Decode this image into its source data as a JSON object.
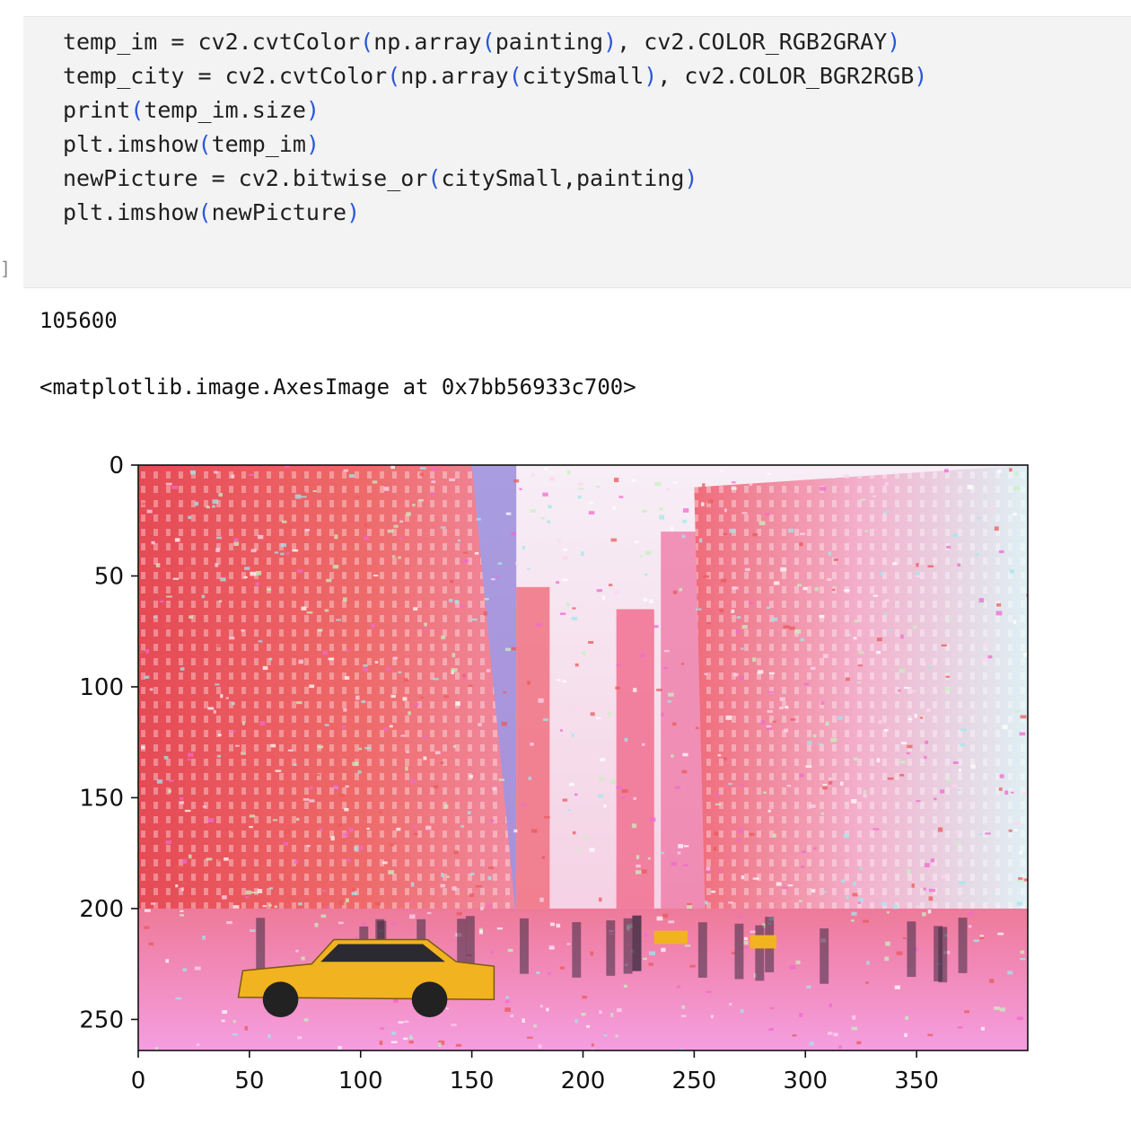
{
  "cell": {
    "prompt": "]",
    "lines": [
      [
        [
          "temp_im = cv2.cvtColor",
          ""
        ],
        [
          "(",
          "p"
        ],
        [
          "np.array",
          ""
        ],
        [
          "(",
          "p"
        ],
        [
          "painting",
          ""
        ],
        [
          ")",
          "p"
        ],
        [
          ", cv2.COLOR_RGB2GRAY",
          ""
        ],
        [
          ")",
          "p"
        ]
      ],
      [
        [
          "temp_city = cv2.cvtColor",
          ""
        ],
        [
          "(",
          "p"
        ],
        [
          "np.array",
          ""
        ],
        [
          "(",
          "p"
        ],
        [
          "citySmall",
          ""
        ],
        [
          ")",
          "p"
        ],
        [
          ", cv2.COLOR_BGR2RGB",
          ""
        ],
        [
          ")",
          "p"
        ]
      ],
      [
        [
          "print",
          ""
        ],
        [
          "(",
          "p"
        ],
        [
          "temp_im.size",
          ""
        ],
        [
          ")",
          "p"
        ]
      ],
      [
        [
          "plt.imshow",
          ""
        ],
        [
          "(",
          "p"
        ],
        [
          "temp_im",
          ""
        ],
        [
          ")",
          "p"
        ]
      ],
      [
        [
          "newPicture = cv2.bitwise_or",
          ""
        ],
        [
          "(",
          "p"
        ],
        [
          "citySmall,painting",
          ""
        ],
        [
          ")",
          "p"
        ]
      ],
      [
        [
          "plt.imshow",
          ""
        ],
        [
          "(",
          "p"
        ],
        [
          "newPicture",
          ""
        ],
        [
          ")",
          "p"
        ]
      ]
    ]
  },
  "output": {
    "size_value": "105600",
    "repr": "<matplotlib.image.AxesImage at 0x7bb56933c700>"
  },
  "chart_data": {
    "type": "heatmap",
    "description_free": true,
    "image_width": 400,
    "image_height": 264,
    "xlim": [
      0,
      400
    ],
    "ylim": [
      264,
      0
    ],
    "x_ticks": [
      0,
      50,
      100,
      150,
      200,
      250,
      300,
      350
    ],
    "y_ticks": [
      0,
      50,
      100,
      150,
      200,
      250
    ],
    "colors": {
      "building_red": "#ea5a5a",
      "building_pink": "#f59ab8",
      "sky_white": "#f6eef4",
      "street_magenta": "#f06ad0",
      "taxi_yellow": "#f2b320",
      "cyan_noise": "#9fe8ee"
    }
  }
}
